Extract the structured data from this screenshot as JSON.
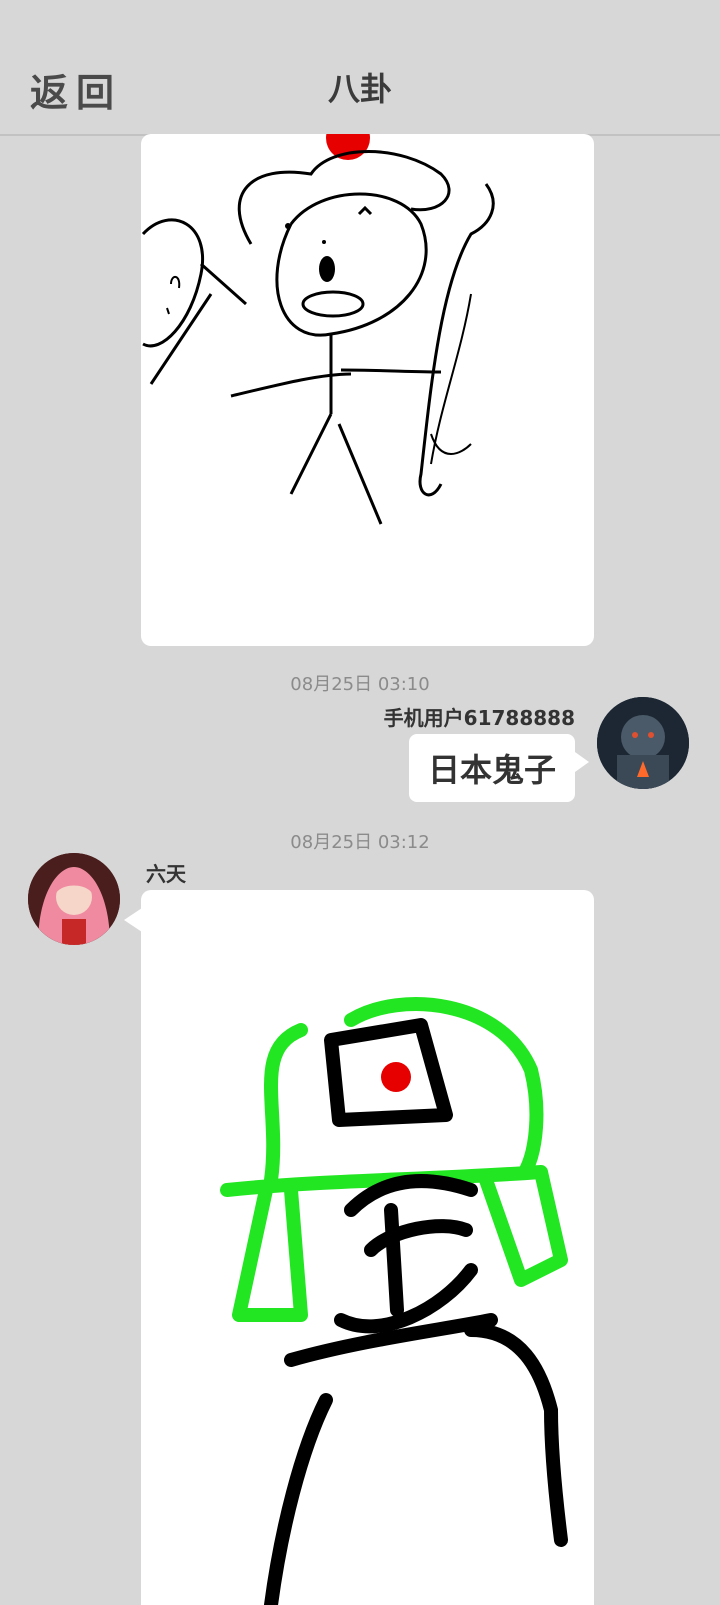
{
  "header": {
    "back_label": "返回",
    "title": "八卦"
  },
  "messages": [
    {
      "id": "m2",
      "time": "08月25日  03:10",
      "sender": "手机用户61788888",
      "text": "日本鬼子"
    },
    {
      "id": "m3",
      "time": "08月25日  03:12",
      "sender": "六天"
    }
  ],
  "colors": {
    "background": "#d7d7d7",
    "bubble": "#ffffff",
    "stroke": "#000000",
    "accent_green": "#22e622",
    "accent_red": "#e60000"
  },
  "icons": {
    "avatar_user_icon": "avatar-robot-icon",
    "avatar_other_icon": "avatar-anime-girl-icon"
  }
}
